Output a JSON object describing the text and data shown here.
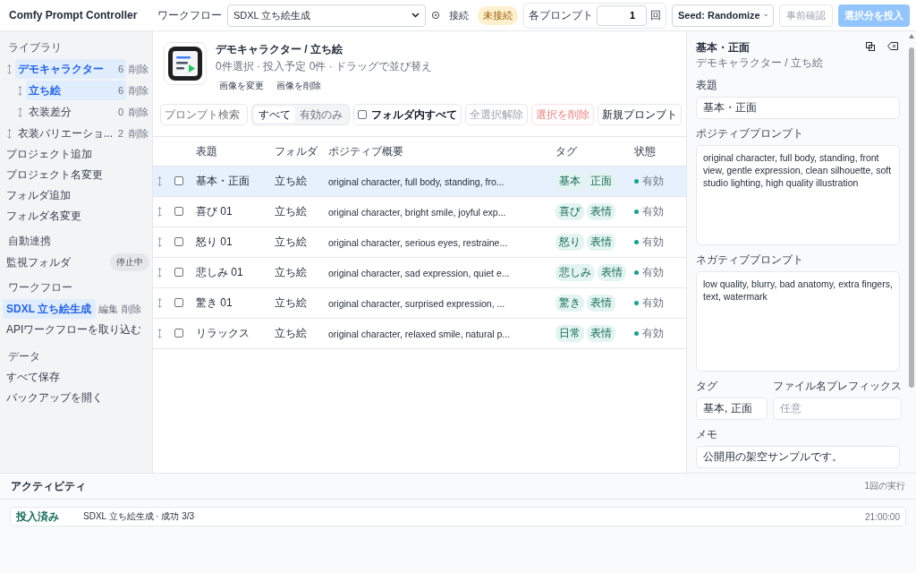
{
  "header": {
    "title": "Comfy Prompt Controller",
    "workflow_label": "ワークフロー",
    "workflow_value": "SDXL 立ち絵生成",
    "connect_button": "接続",
    "connection_status": "未接続",
    "count_label": "各プロンプト",
    "count_value": "1",
    "count_unit": "回",
    "seed_value": "Seed: Randomize",
    "preview_button": {
      "label": "事前確認",
      "disabled": true
    },
    "submit_button": {
      "label": "選択分を投入",
      "disabled": true
    }
  },
  "sidebar": {
    "library": {
      "heading": "ライブラリ",
      "items": [
        {
          "label": "デモキャラクター",
          "count": "6",
          "action": "削除",
          "selected": true,
          "children": [
            {
              "label": "立ち絵",
              "count": "6",
              "action": "削除",
              "selected": true
            },
            {
              "label": "衣装差分",
              "count": "0",
              "action": "削除",
              "selected": false
            }
          ]
        },
        {
          "label": "衣装バリエーショ...",
          "count": "2",
          "action": "削除",
          "selected": false
        }
      ],
      "actions": [
        "プロジェクト追加",
        "プロジェクト名変更",
        "フォルダ追加",
        "フォルダ名変更"
      ]
    },
    "automation": {
      "heading": "自動連携",
      "item": "監視フォルダ",
      "status": "停止中"
    },
    "workflows": {
      "heading": "ワークフロー",
      "items": [
        {
          "label": "SDXL 立ち絵生成",
          "edit": "編集",
          "delete": "削除",
          "selected": true
        }
      ],
      "actions": [
        "APIワークフローを取り込む"
      ]
    },
    "data": {
      "heading": "データ",
      "actions": [
        "すべて保存",
        "バックアップを開く"
      ]
    }
  },
  "folder": {
    "title": "デモキャラクター / 立ち絵",
    "subtitle": "0件選択 · 投入予定 0件 · ドラッグで並び替え",
    "image_actions": [
      "画像を変更",
      "画像を削除"
    ]
  },
  "toolbar": {
    "search_placeholder": "プロンプト検索",
    "filters": [
      {
        "label": "すべて",
        "selected": true
      },
      {
        "label": "有効のみ",
        "selected": false
      }
    ],
    "select_all": {
      "label": "フォルダ内すべて",
      "checked": false
    },
    "clear_button": "全選択解除",
    "delete_button": "選択を削除",
    "new_button": "新規プロンプト"
  },
  "table": {
    "columns": [
      "表題",
      "フォルダ",
      "ポジティブ概要",
      "タグ",
      "状態"
    ],
    "rows": [
      {
        "title": "基本・正面",
        "folder": "立ち絵",
        "summary": "original character, full body, standing, fro...",
        "tags": [
          "基本",
          "正面"
        ],
        "status": "有効",
        "checked": false,
        "selected": true
      },
      {
        "title": "喜び 01",
        "folder": "立ち絵",
        "summary": "original character, bright smile, joyful exp...",
        "tags": [
          "喜び",
          "表情"
        ],
        "status": "有効",
        "checked": false,
        "selected": false
      },
      {
        "title": "怒り 01",
        "folder": "立ち絵",
        "summary": "original character, serious eyes, restraine...",
        "tags": [
          "怒り",
          "表情"
        ],
        "status": "有効",
        "checked": false,
        "selected": false
      },
      {
        "title": "悲しみ 01",
        "folder": "立ち絵",
        "summary": "original character, sad expression, quiet e...",
        "tags": [
          "悲しみ",
          "表情"
        ],
        "status": "有効",
        "checked": false,
        "selected": false
      },
      {
        "title": "驚き 01",
        "folder": "立ち絵",
        "summary": "original character, surprised expression, ...",
        "tags": [
          "驚き",
          "表情"
        ],
        "status": "有効",
        "checked": false,
        "selected": false
      },
      {
        "title": "リラックス",
        "folder": "立ち絵",
        "summary": "original character, relaxed smile, natural p...",
        "tags": [
          "日常",
          "表情"
        ],
        "status": "有効",
        "checked": false,
        "selected": false
      }
    ]
  },
  "editor": {
    "title": "基本・正面",
    "subtitle": "デモキャラクター / 立ち絵",
    "fields": [
      {
        "kind": "input",
        "label": "表題",
        "value": "基本・正面"
      },
      {
        "kind": "textarea",
        "label": "ポジティブプロンプト",
        "value": "original character, full body, standing, front view, gentle expression, clean silhouette, soft studio lighting, high quality illustration"
      },
      {
        "kind": "textarea",
        "label": "ネガティブプロンプト",
        "value": "low quality, blurry, bad anatomy, extra fingers, text, watermark"
      },
      {
        "kind": "pair",
        "items": [
          {
            "label": "タグ",
            "value": "基本, 正面"
          },
          {
            "label": "ファイル名プレフィックス",
            "placeholder": "任意"
          }
        ]
      },
      {
        "kind": "memo",
        "label": "メモ",
        "value": "公開用の架空サンプルです。"
      }
    ]
  },
  "activity": {
    "title": "アクティビティ",
    "count": "1回の実行",
    "entries": [
      {
        "status": "投入済み",
        "message": "SDXL 立ち絵生成 · 成功 3/3",
        "time": "21:00:00"
      }
    ]
  }
}
